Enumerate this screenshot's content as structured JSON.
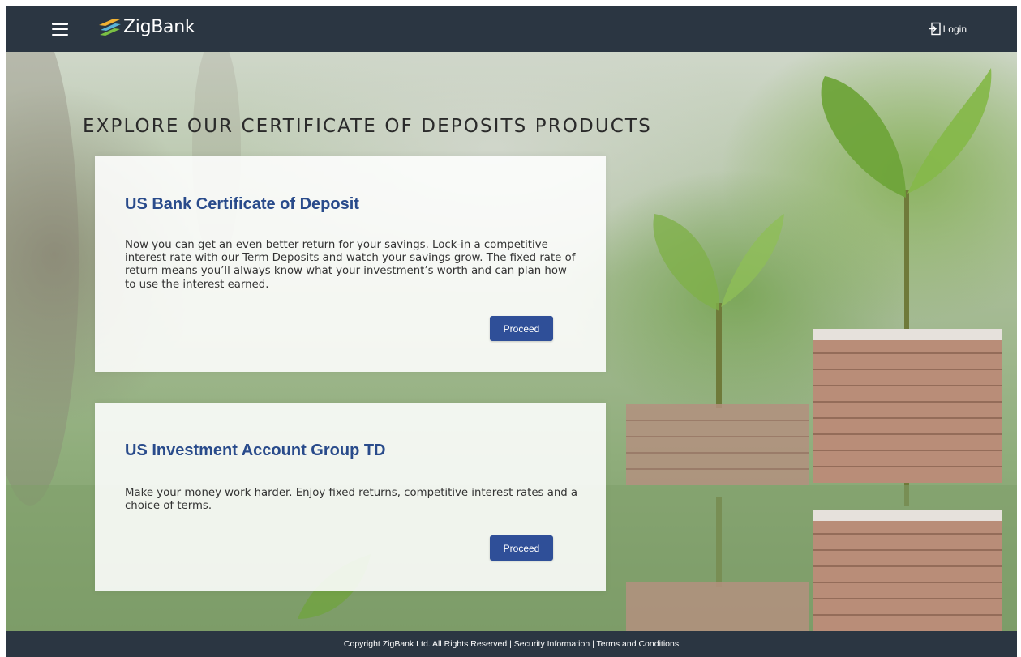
{
  "header": {
    "brand": "ZigBank",
    "login_label": "Login",
    "icons": {
      "menu": "hamburger-menu-icon",
      "logo": "zigbank-logo-icon",
      "login": "login-icon"
    }
  },
  "hero": {
    "title": "EXPLORE OUR CERTIFICATE OF DEPOSITS PRODUCTS"
  },
  "products": [
    {
      "title": "US Bank Certificate of Deposit",
      "description": "Now you can get an even better return for your savings. Lock-in a competitive interest rate with our Term Deposits and watch your savings grow. The fixed rate of return means you’ll always know what your investment’s worth and can plan how to use the interest earned.",
      "button_label": "Proceed"
    },
    {
      "title": "US Investment Account Group TD",
      "description": "Make your money work harder. Enjoy fixed returns, competitive interest rates and a choice of terms.",
      "button_label": "Proceed"
    }
  ],
  "footer": {
    "text": "Copyright ZigBank Ltd. All Rights Reserved | Security Information | Terms and Conditions"
  },
  "colors": {
    "header_bg": "#2b3642",
    "accent": "#2f4f98",
    "title_blue": "#294b8b"
  }
}
